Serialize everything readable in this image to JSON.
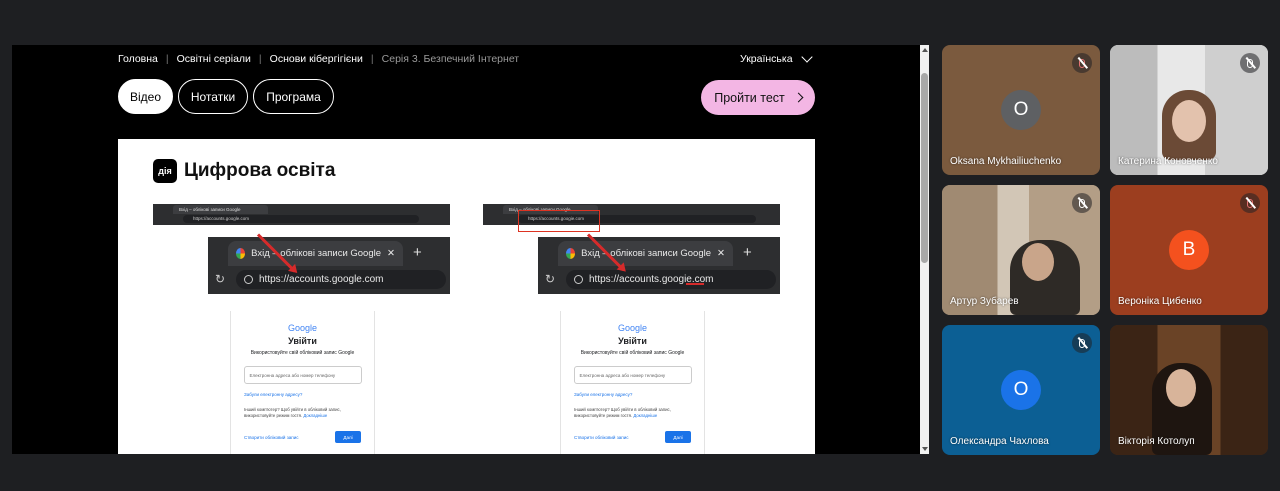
{
  "breadcrumbs": [
    "Головна",
    "Освітні серіали",
    "Основи кібергігієни",
    "Серія 3. Безпечний Інтернет"
  ],
  "language": "Українська",
  "tabs": [
    {
      "label": "Відео",
      "active": true
    },
    {
      "label": "Нотатки",
      "active": false
    },
    {
      "label": "Програма",
      "active": false
    }
  ],
  "test_button": "Пройти тест",
  "slide": {
    "logo": "дія",
    "title": "Цифрова освіта",
    "left": {
      "mini_tab": "Вхід – облікові записи Google",
      "mini_url": "https://accounts.google.com",
      "zoom_tab": "Вхід – облікові записи Google",
      "zoom_url": "https://accounts.google.com"
    },
    "right": {
      "mini_tab": "Вхід – облікові записи Google",
      "mini_url": "https://accounts.googie.com",
      "zoom_tab": "Вхід – облікові записи Google",
      "zoom_url": "https://accounts.googie.com"
    },
    "google_form": {
      "logo": "Google",
      "heading": "Увійти",
      "sub": "Використовуйте свій обліковий запис Google",
      "placeholder": "Електронна адреса або номер телефону",
      "forgot": "Забули електронну адресу?",
      "guest": "Інший комп'ютер? Щоб увійти в обліковий запис, використовуйте режим гостя.",
      "guest_link": "Докладніше",
      "create": "Створити обліковий запис",
      "next": "Далі"
    }
  },
  "participants": [
    {
      "name": "Oksana Mykhailiuchenko",
      "initial": "O",
      "bg": "#7b5a3e",
      "avatar_bg": "#5e6063",
      "muted": true
    },
    {
      "name": "Катерина Коновченко",
      "initial": "",
      "bg": "#cfcfcf",
      "muted": true
    },
    {
      "name": "Артур Зубарев",
      "initial": "",
      "bg": "#8d7a64",
      "muted": true
    },
    {
      "name": "Вероніка Цибенко",
      "initial": "В",
      "bg": "#9c3e1f",
      "avatar_bg": "#f4511e",
      "muted": true
    },
    {
      "name": "Олександра Чахлова",
      "initial": "О",
      "bg": "#0c5f94",
      "avatar_bg": "#1a73e8",
      "muted": true
    },
    {
      "name": "Вікторія Котолуп",
      "initial": "",
      "bg": "#4a2c18",
      "muted": false
    }
  ],
  "colors": {
    "accent_pink": "#f3b6e4",
    "meet_bg": "#1e1f22",
    "google_blue": "#1a73e8",
    "warning_red": "#d62b2b"
  }
}
